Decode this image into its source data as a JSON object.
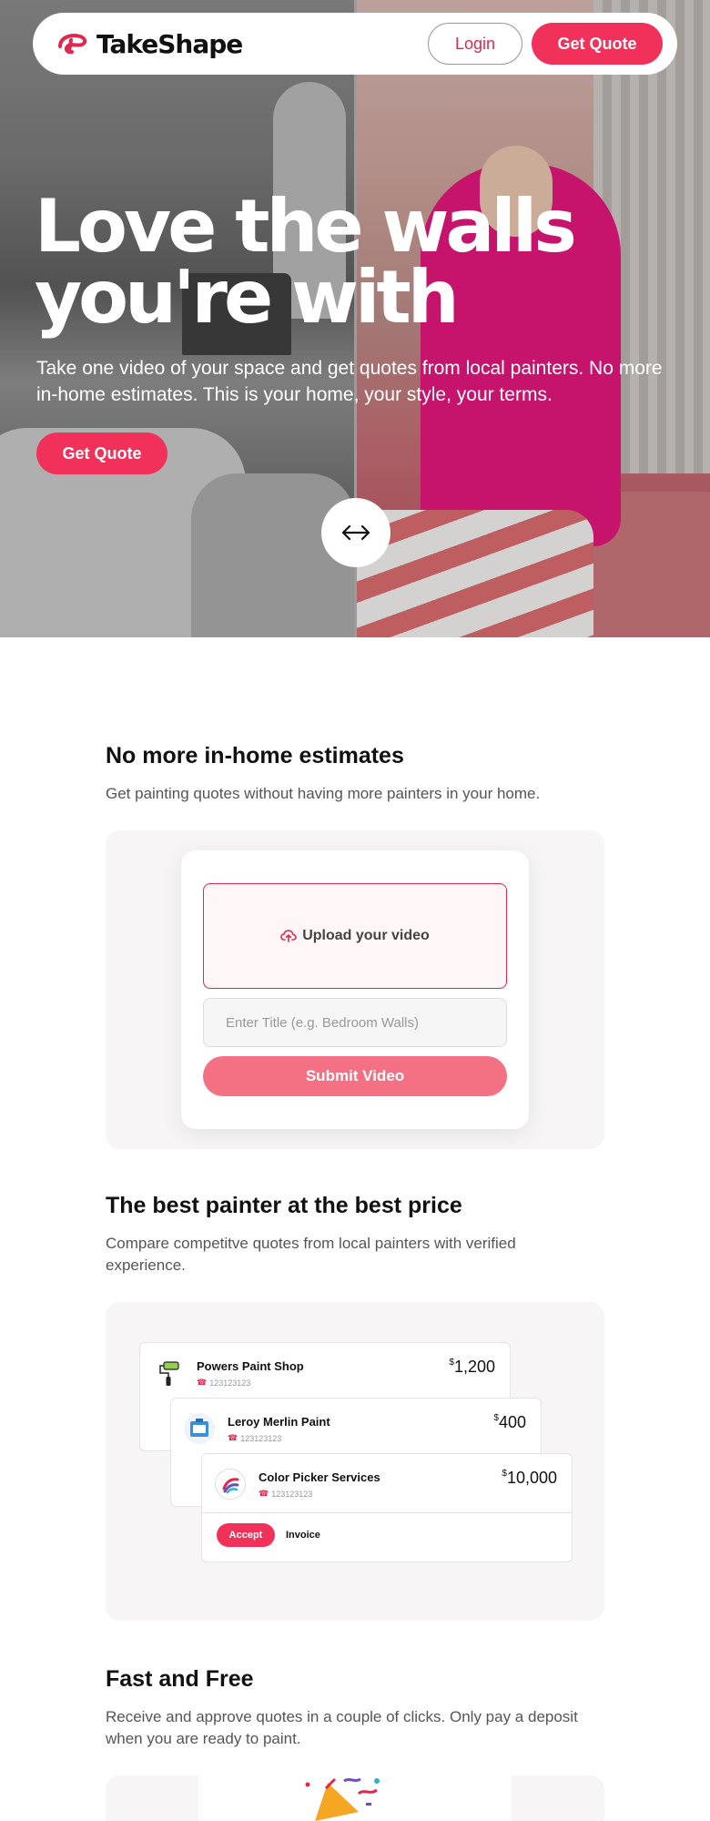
{
  "brand": {
    "name": "TakeShape",
    "accent": "#f2315a"
  },
  "nav": {
    "login_label": "Login",
    "quote_label": "Get Quote"
  },
  "hero": {
    "title_line1": "Love the walls",
    "title_line2": "you're with",
    "subtitle": "Take one video of your space and get quotes from local painters. No more in-home estimates. This is your home, your style, your terms.",
    "cta_label": "Get Quote",
    "compare_icon": "arrows-left-right-icon"
  },
  "section1": {
    "title": "No more in-home estimates",
    "desc": "Get painting quotes without having more painters in your home.",
    "upload_label": "Upload your video",
    "title_placeholder": "Enter Title (e.g. Bedroom Walls)",
    "submit_label": "Submit Video"
  },
  "section2": {
    "title": "The best painter at the best price",
    "desc": "Compare competitve quotes from local painters with verified experience.",
    "quotes": [
      {
        "name": "Powers Paint Shop",
        "phone": "123123123",
        "currency": "$",
        "price": "1,200"
      },
      {
        "name": "Leroy Merlin Paint",
        "phone": "123123123",
        "currency": "$",
        "price": "400"
      },
      {
        "name": "Color Picker Services",
        "phone": "123123123",
        "currency": "$",
        "price": "10,000"
      }
    ],
    "accept_label": "Accept",
    "invoice_label": "Invoice"
  },
  "section3": {
    "title": "Fast and Free",
    "desc": "Receive and approve quotes in a couple of clicks. Only pay a deposit when you are ready to paint."
  }
}
